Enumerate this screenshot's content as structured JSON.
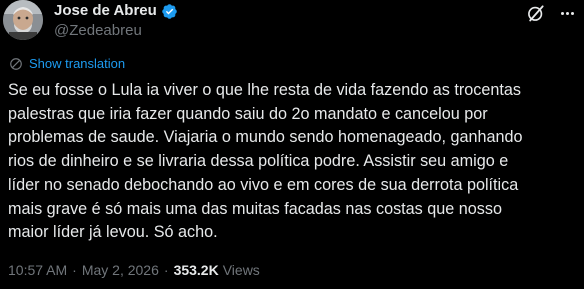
{
  "author": {
    "display_name": "Jose de Abreu",
    "handle": "@Zedeabreu",
    "verified": true,
    "verified_color": "#1d9bf0"
  },
  "actions": {
    "grok_icon": "grok-icon",
    "more_icon": "more-options-icon"
  },
  "translation": {
    "label": "Show translation",
    "icon": "globe-icon",
    "color": "#1d9bf0"
  },
  "tweet": {
    "lines": [
      "Se eu fosse o Lula ia viver o que lhe resta de vida fazendo as trocentas",
      "palestras que iria fazer quando saiu do 2o mandato e cancelou por",
      "problemas de saude. Viajaria o mundo sendo homenageado, ganhando",
      "rios de dinheiro e se livraria dessa política podre. Assistir seu amigo e",
      "líder no senado debochando ao vivo e em cores de sua derrota política",
      "mais grave é só mais uma das muitas facadas nas costas que nosso",
      "maior líder já levou. Só acho."
    ]
  },
  "meta": {
    "time": "10:57 AM",
    "separator": "·",
    "date": "May 2, 2026",
    "views_count": "353.2K",
    "views_label": "Views"
  },
  "colors": {
    "background": "#000000",
    "text_primary": "#e7e9ea",
    "text_secondary": "#71767b",
    "link": "#1d9bf0"
  }
}
